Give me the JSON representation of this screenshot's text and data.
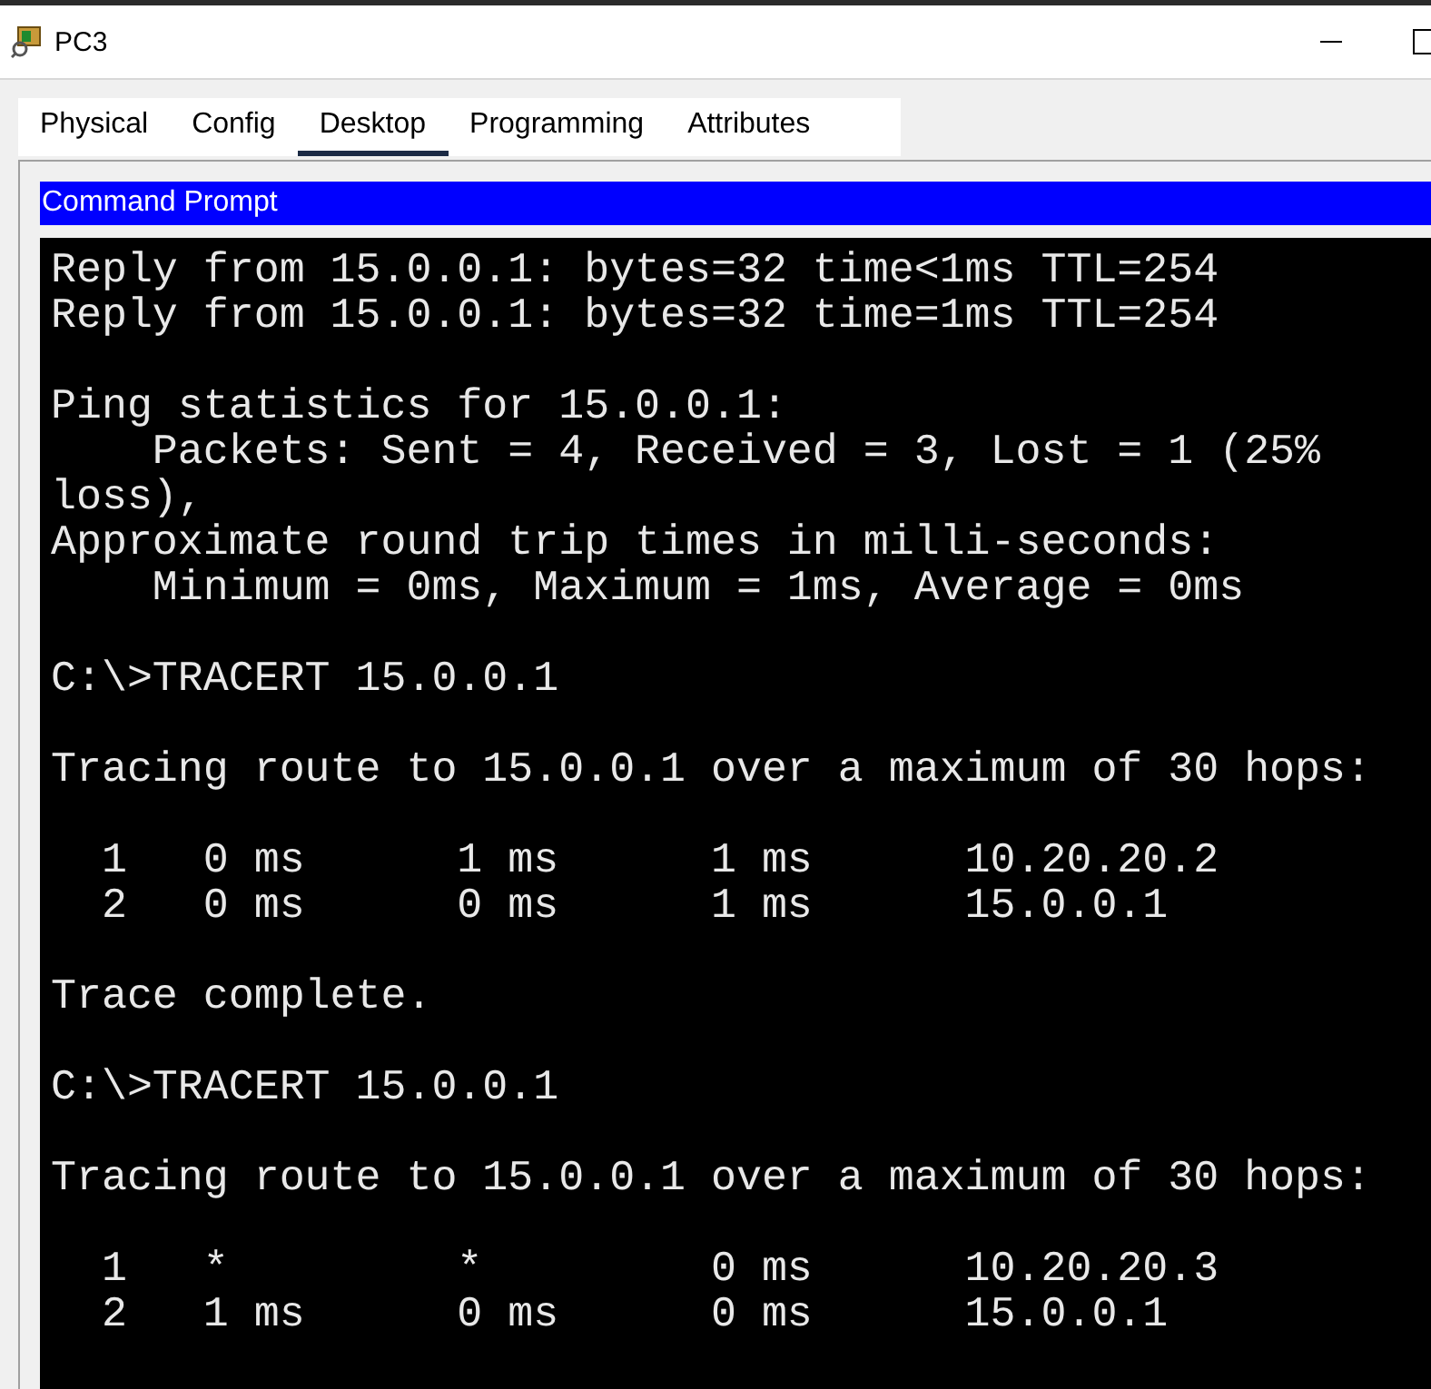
{
  "window": {
    "title": "PC3"
  },
  "tabs": [
    {
      "label": "Physical",
      "selected": false
    },
    {
      "label": "Config",
      "selected": false
    },
    {
      "label": "Desktop",
      "selected": true
    },
    {
      "label": "Programming",
      "selected": false
    },
    {
      "label": "Attributes",
      "selected": false
    }
  ],
  "panel": {
    "title": "Command Prompt"
  },
  "terminal": {
    "blocks": [
      [
        "Reply from 15.0.0.1: bytes=32 time<1ms TTL=254",
        "Reply from 15.0.0.1: bytes=32 time=1ms TTL=254"
      ],
      [
        "Ping statistics for 15.0.0.1:",
        "    Packets: Sent = 4, Received = 3, Lost = 1 (25%",
        "loss),",
        "Approximate round trip times in milli-seconds:",
        "    Minimum = 0ms, Maximum = 1ms, Average = 0ms"
      ],
      [
        "C:\\>TRACERT 15.0.0.1"
      ],
      [
        "Tracing route to 15.0.0.1 over a maximum of 30 hops:"
      ],
      [
        "  1   0 ms      1 ms      1 ms      10.20.20.2",
        "  2   0 ms      0 ms      1 ms      15.0.0.1"
      ],
      [
        "Trace complete."
      ],
      [
        "C:\\>TRACERT 15.0.0.1"
      ],
      [
        "Tracing route to 15.0.0.1 over a maximum of 30 hops:"
      ],
      [
        "  1   *         *         0 ms      10.20.20.3",
        "  2   1 ms      0 ms      0 ms      15.0.0.1"
      ]
    ]
  }
}
